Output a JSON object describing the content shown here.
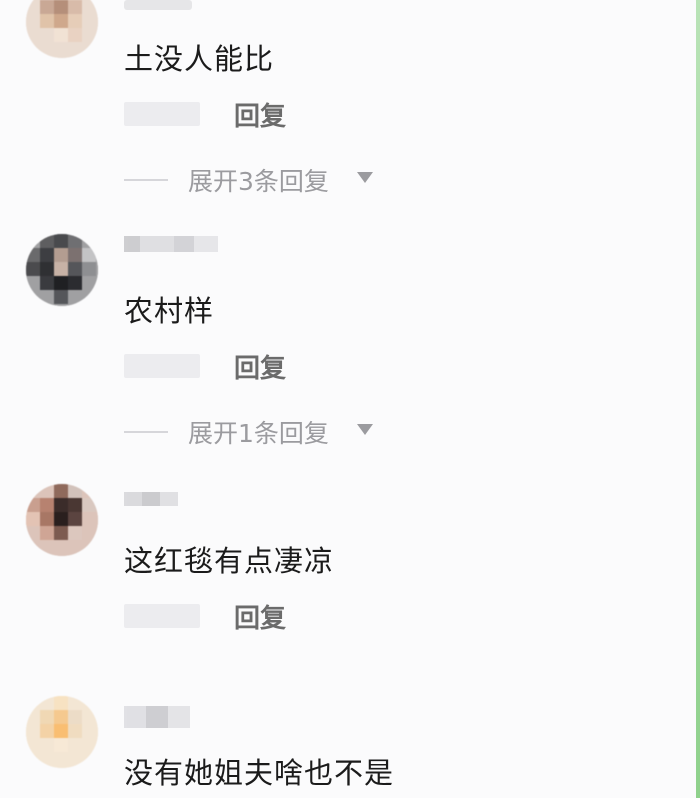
{
  "comments": [
    {
      "text": "土没人能比",
      "reply_label": "回复",
      "expand_label": "展开3条回复"
    },
    {
      "text": "农村样",
      "reply_label": "回复",
      "expand_label": "展开1条回复"
    },
    {
      "text": "这红毯有点凄凉",
      "reply_label": "回复"
    },
    {
      "text": "没有她姐夫啥也不是"
    }
  ],
  "icons": {
    "expand_caret": "caret-down-icon"
  },
  "colors": {
    "background": "#fbfbfc",
    "text": "#1b1b1b",
    "reply": "#6b6b6b",
    "expand": "#9b9b9f",
    "green_edge": "#8fd18c"
  }
}
